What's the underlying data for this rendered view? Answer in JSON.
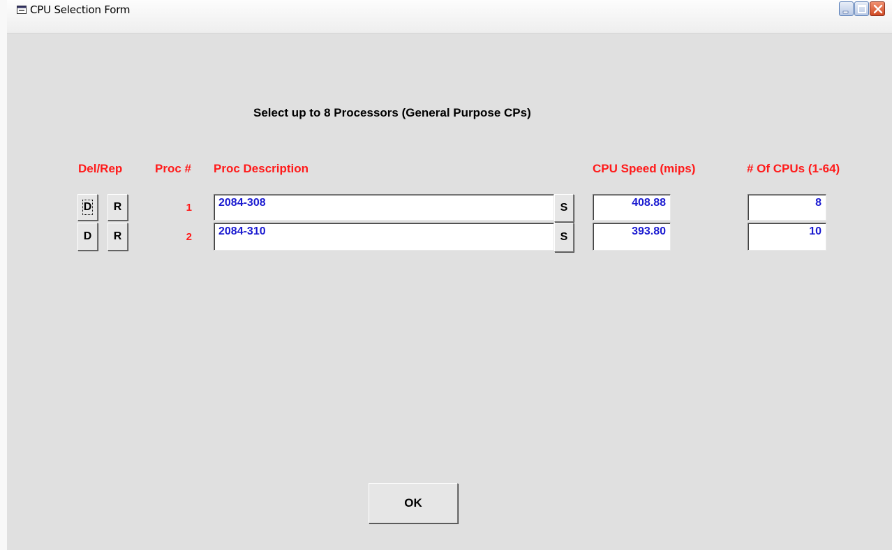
{
  "window": {
    "title": "CPU Selection Form"
  },
  "form": {
    "heading": "Select up to 8 Processors (General Purpose CPs)",
    "columns": {
      "del_rep": "Del/Rep",
      "proc_num": "Proc #",
      "proc_description": "Proc Description",
      "cpu_speed": "CPU Speed (mips)",
      "num_cpus": "# Of CPUs (1-64)"
    },
    "rows": [
      {
        "delete_label": "D",
        "replace_label": "R",
        "proc_num": "1",
        "description": "2084-308",
        "select_label": "S",
        "speed": "408.88",
        "cpus": "8"
      },
      {
        "delete_label": "D",
        "replace_label": "R",
        "proc_num": "2",
        "description": "2084-310",
        "select_label": "S",
        "speed": "393.80",
        "cpus": "10"
      }
    ],
    "ok_label": "OK"
  },
  "colors": {
    "label_red": "#ff1a1a",
    "value_blue": "#1a1ad0",
    "background": "#e0e0e0"
  }
}
